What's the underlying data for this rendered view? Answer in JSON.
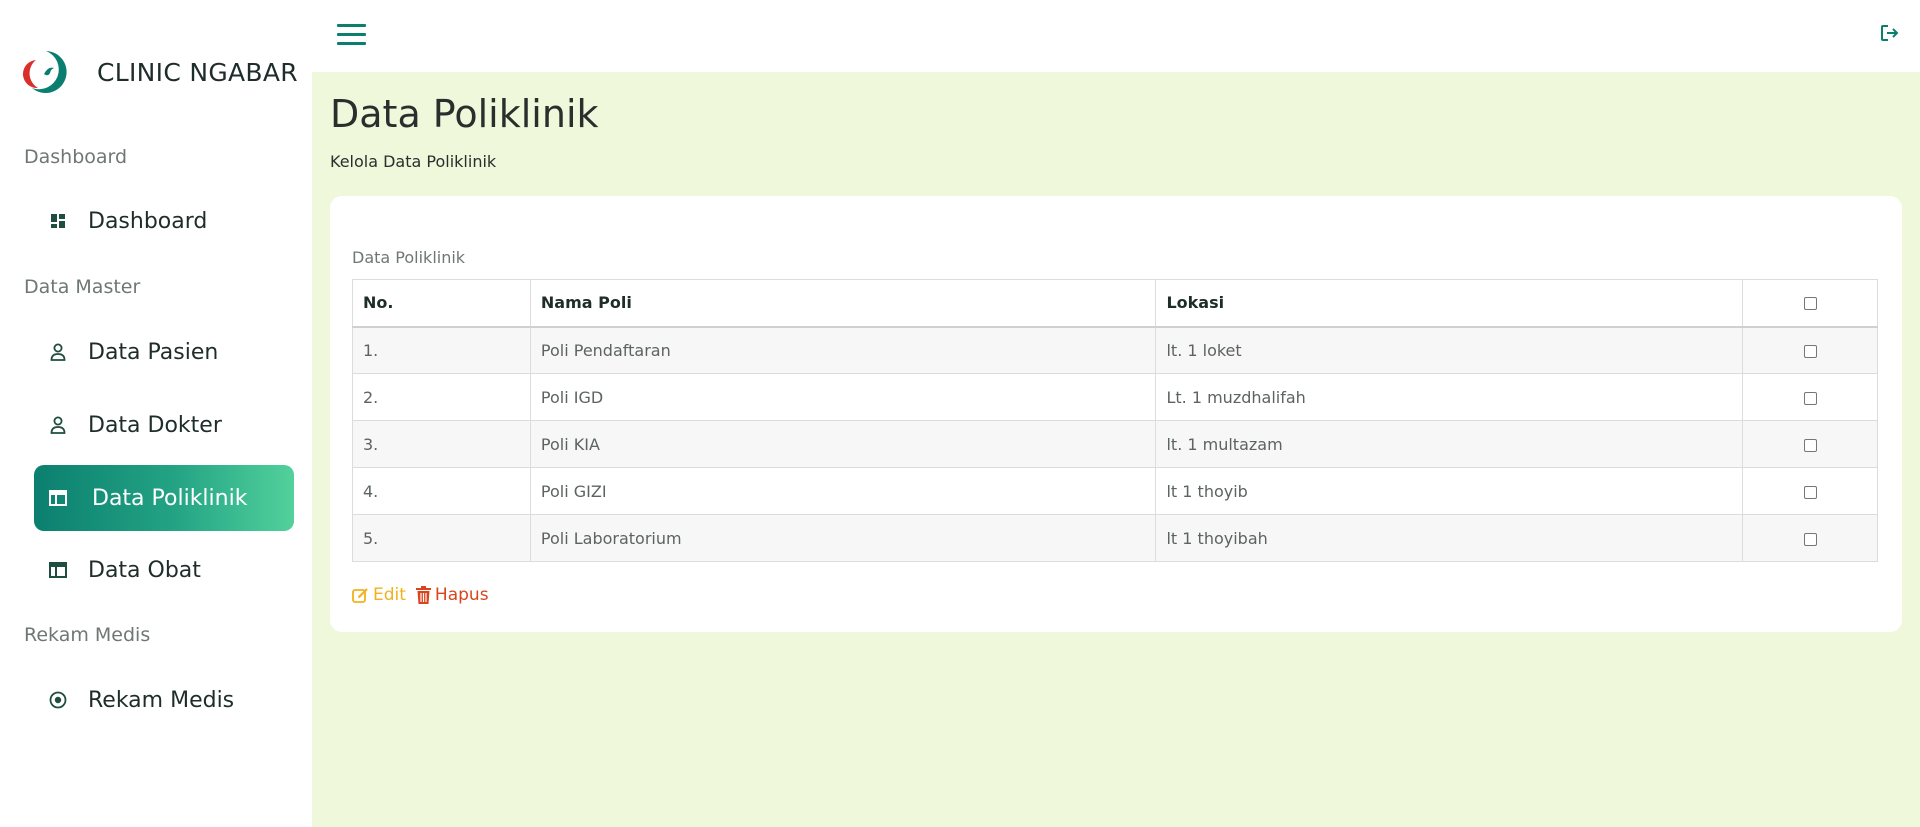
{
  "brand": {
    "name": "CLINIC NGABAR"
  },
  "sidebar": {
    "sections": [
      {
        "label": "Dashboard"
      },
      {
        "label": "Data Master"
      },
      {
        "label": "Rekam Medis"
      }
    ],
    "items": [
      {
        "label": "Dashboard",
        "icon": "dashboard-grid-icon"
      },
      {
        "label": "Data Pasien",
        "icon": "user-icon"
      },
      {
        "label": "Data Dokter",
        "icon": "user-icon"
      },
      {
        "label": "Data Poliklinik",
        "icon": "table-icon",
        "active": true
      },
      {
        "label": "Data Obat",
        "icon": "table-icon"
      },
      {
        "label": "Rekam Medis",
        "icon": "radio-circle-icon"
      }
    ]
  },
  "topbar": {
    "menu_icon": "hamburger-icon",
    "logout_icon": "logout-icon"
  },
  "page": {
    "title": "Data Poliklinik",
    "subtitle": "Kelola Data Poliklinik"
  },
  "table": {
    "caption": "Data Poliklinik",
    "headers": [
      "No.",
      "Nama Poli",
      "Lokasi"
    ],
    "rows": [
      {
        "no": "1.",
        "nama": "Poli Pendaftaran",
        "lokasi": "lt. 1 loket"
      },
      {
        "no": "2.",
        "nama": "Poli IGD",
        "lokasi": "Lt. 1 muzdhalifah"
      },
      {
        "no": "3.",
        "nama": "Poli KIA",
        "lokasi": "lt. 1 multazam"
      },
      {
        "no": "4.",
        "nama": "Poli GIZI",
        "lokasi": "lt 1 thoyib"
      },
      {
        "no": "5.",
        "nama": "Poli Laboratorium",
        "lokasi": "lt 1 thoyibah"
      }
    ]
  },
  "actions": {
    "edit_label": "Edit",
    "hapus_label": "Hapus"
  },
  "colors": {
    "accent": "#0b7f6f",
    "accent_light": "#52d19c",
    "main_bg": "#f0f8dc",
    "edit": "#f2b11d",
    "hapus": "#d9441b"
  }
}
